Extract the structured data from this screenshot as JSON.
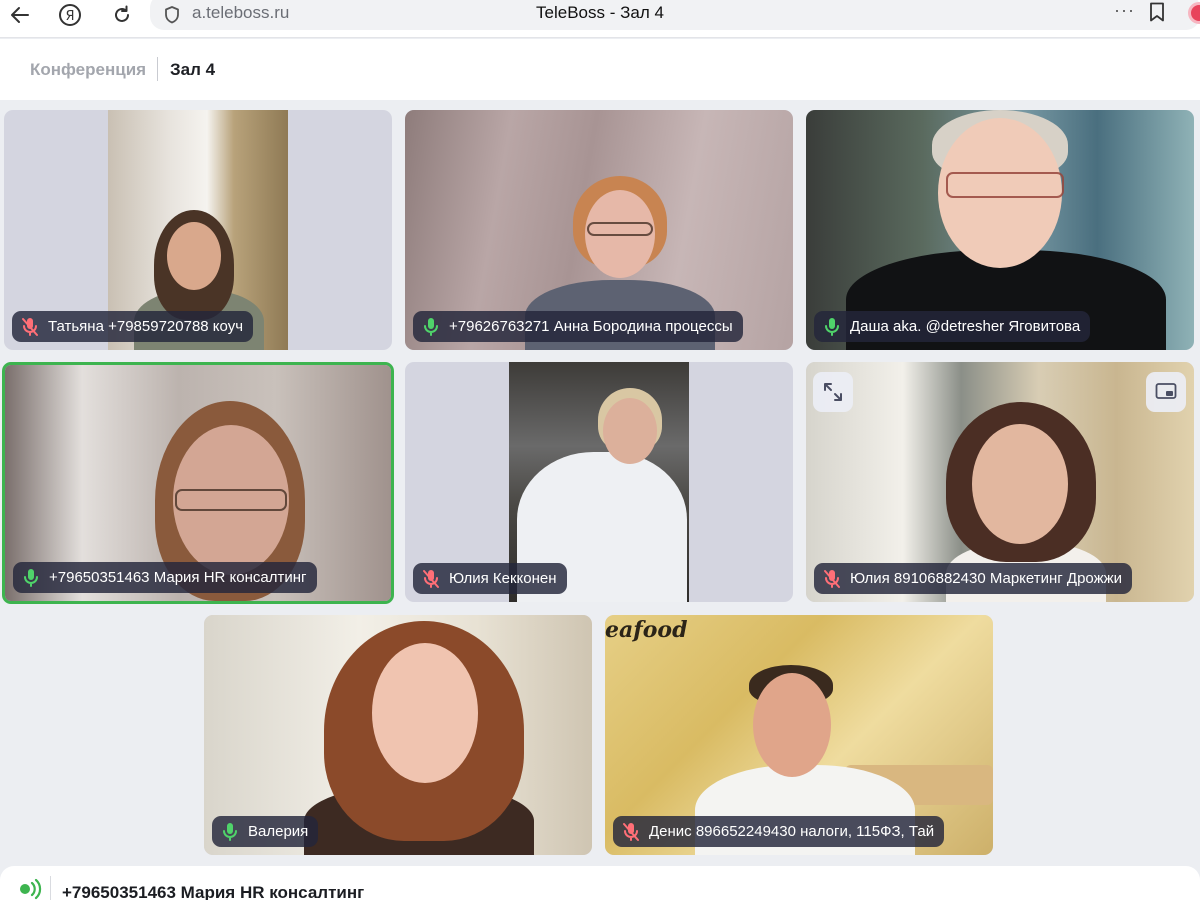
{
  "browser": {
    "url": "a.teleboss.ru",
    "tab_title": "TeleBoss - Зал 4",
    "more_label": "···"
  },
  "breadcrumb": {
    "root": "Конференция",
    "current": "Зал 4"
  },
  "participants": [
    {
      "name": "Татьяна +79859720788 коуч",
      "mic": "muted"
    },
    {
      "name": "+79626763271 Анна Бородина процессы",
      "mic": "on"
    },
    {
      "name": "Даша aka. @detresher Яговитова",
      "mic": "on"
    },
    {
      "name": "+79650351463 Мария HR консалтинг",
      "mic": "on",
      "speaking": true
    },
    {
      "name": "Юлия Кекконен",
      "mic": "muted"
    },
    {
      "name": "Юлия 89106882430 Маркетинг Дрожжи",
      "mic": "muted"
    },
    {
      "name": "Валерия",
      "mic": "on"
    },
    {
      "name": "Денис 896652249430 налоги, 115ФЗ, Тай",
      "mic": "muted"
    }
  ],
  "background_sign": "eafood",
  "current_speaker": "+79650351463 Мария HR консалтинг",
  "colors": {
    "mic_on": "#4fd36a",
    "mic_muted": "#ff6f77",
    "active_border": "#3db44f",
    "badge_bg": "#23263a"
  },
  "icons": {
    "mic_on": "microphone-icon",
    "mic_muted": "microphone-muted-icon",
    "expand": "expand-icon",
    "pip": "picture-in-picture-icon",
    "speaking": "speaking-icon"
  }
}
